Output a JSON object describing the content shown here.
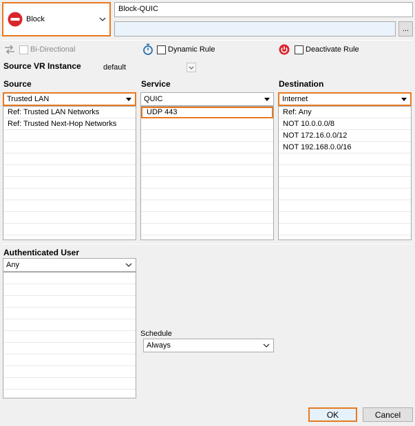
{
  "action": {
    "label": "Block"
  },
  "rule_name": {
    "value": "Block-QUIC"
  },
  "comment": {
    "value": "",
    "browse_label": "..."
  },
  "options": {
    "bidirectional": "Bi-Directional",
    "dynamic_rule": "Dynamic Rule",
    "deactivate_rule": "Deactivate Rule"
  },
  "source_vr": {
    "label": "Source VR Instance",
    "value": "default"
  },
  "source": {
    "label": "Source",
    "selected": "Trusted  LAN",
    "items": [
      "Ref: Trusted LAN Networks",
      "Ref: Trusted Next-Hop Networks"
    ]
  },
  "service": {
    "label": "Service",
    "selected": "QUIC",
    "items": [
      "UDP  443"
    ]
  },
  "destination": {
    "label": "Destination",
    "selected": "Internet",
    "items": [
      "Ref: Any",
      "NOT 10.0.0.0/8",
      "NOT 172.16.0.0/12",
      "NOT 192.168.0.0/16"
    ]
  },
  "auth_user": {
    "label": "Authenticated User",
    "selected": "Any"
  },
  "schedule": {
    "label": "Schedule",
    "selected": "Always"
  },
  "buttons": {
    "ok": "OK",
    "cancel": "Cancel"
  },
  "colors": {
    "accent": "#e8791f",
    "block_red": "#d9262c",
    "timer_blue": "#2a6fb0"
  }
}
